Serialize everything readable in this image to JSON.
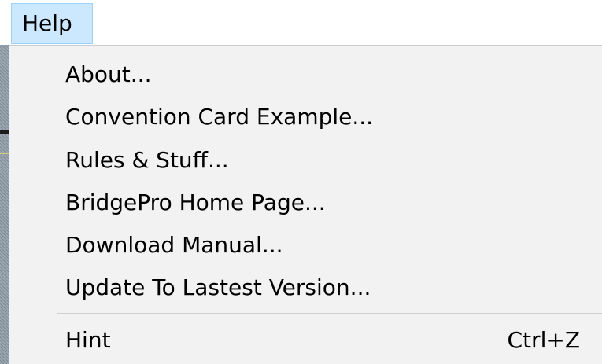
{
  "menubar": {
    "active_menu": "Help"
  },
  "help_menu": {
    "items": [
      {
        "label": "About..."
      },
      {
        "label": "Convention Card Example..."
      },
      {
        "label": "Rules & Stuff..."
      },
      {
        "label": "BridgePro Home Page..."
      },
      {
        "label": "Download Manual..."
      },
      {
        "label": "Update To Lastest Version..."
      }
    ],
    "hint": {
      "label": "Hint",
      "shortcut": "Ctrl+Z"
    }
  },
  "colors": {
    "menubar_highlight": "#cce8ff",
    "dropdown_background": "#f2f2f2",
    "separator": "#d0d0d0"
  }
}
